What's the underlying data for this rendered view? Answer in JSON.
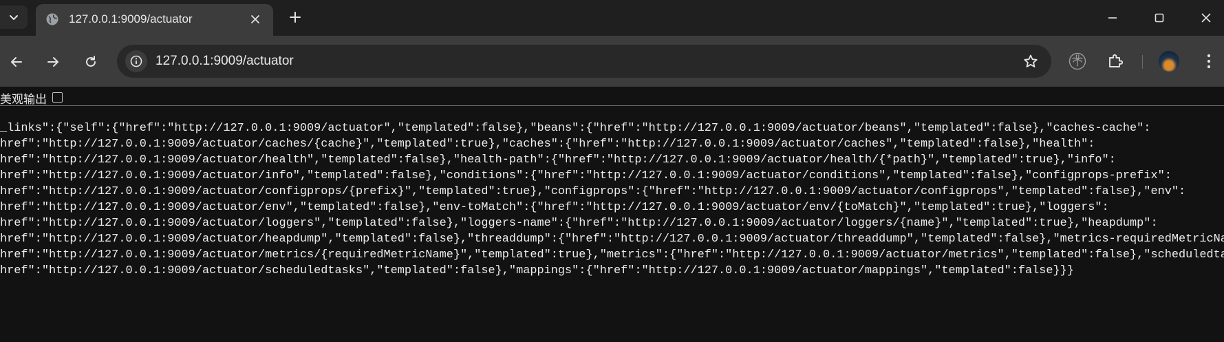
{
  "browser": {
    "tab": {
      "title": "127.0.0.1:9009/actuator"
    },
    "address_bar": {
      "url": "127.0.0.1:9009/actuator"
    },
    "icons": [
      "tab-search-icon",
      "globe-favicon-icon",
      "close-icon",
      "plus-icon",
      "minimize-icon",
      "maximize-icon",
      "window-close-icon",
      "back-arrow-icon",
      "forward-arrow-icon",
      "reload-icon",
      "site-info-icon",
      "bookmark-star-icon",
      "extension-palm-icon",
      "extensions-puzzle-icon",
      "profile-avatar",
      "more-menu-icon"
    ]
  },
  "page": {
    "pretty_print_label": "美观输出",
    "pretty_print_checked": false,
    "json_lines": [
      "_links\":{\"self\":{\"href\":\"http://127.0.0.1:9009/actuator\",\"templated\":false},\"beans\":{\"href\":\"http://127.0.0.1:9009/actuator/beans\",\"templated\":false},\"caches-cache\":",
      "href\":\"http://127.0.0.1:9009/actuator/caches/{cache}\",\"templated\":true},\"caches\":{\"href\":\"http://127.0.0.1:9009/actuator/caches\",\"templated\":false},\"health\":",
      "href\":\"http://127.0.0.1:9009/actuator/health\",\"templated\":false},\"health-path\":{\"href\":\"http://127.0.0.1:9009/actuator/health/{*path}\",\"templated\":true},\"info\":",
      "href\":\"http://127.0.0.1:9009/actuator/info\",\"templated\":false},\"conditions\":{\"href\":\"http://127.0.0.1:9009/actuator/conditions\",\"templated\":false},\"configprops-prefix\":",
      "href\":\"http://127.0.0.1:9009/actuator/configprops/{prefix}\",\"templated\":true},\"configprops\":{\"href\":\"http://127.0.0.1:9009/actuator/configprops\",\"templated\":false},\"env\":",
      "href\":\"http://127.0.0.1:9009/actuator/env\",\"templated\":false},\"env-toMatch\":{\"href\":\"http://127.0.0.1:9009/actuator/env/{toMatch}\",\"templated\":true},\"loggers\":",
      "href\":\"http://127.0.0.1:9009/actuator/loggers\",\"templated\":false},\"loggers-name\":{\"href\":\"http://127.0.0.1:9009/actuator/loggers/{name}\",\"templated\":true},\"heapdump\":",
      "href\":\"http://127.0.0.1:9009/actuator/heapdump\",\"templated\":false},\"threaddump\":{\"href\":\"http://127.0.0.1:9009/actuator/threaddump\",\"templated\":false},\"metrics-requiredMetricName\":",
      "href\":\"http://127.0.0.1:9009/actuator/metrics/{requiredMetricName}\",\"templated\":true},\"metrics\":{\"href\":\"http://127.0.0.1:9009/actuator/metrics\",\"templated\":false},\"scheduledtasks\":",
      "href\":\"http://127.0.0.1:9009/actuator/scheduledtasks\",\"templated\":false},\"mappings\":{\"href\":\"http://127.0.0.1:9009/actuator/mappings\",\"templated\":false}}}"
    ]
  },
  "colors": {
    "tabstrip_bg": "#1f1f1f",
    "toolbar_bg": "#3c3c3c",
    "omnibox_bg": "#282828",
    "page_bg": "#121212",
    "text": "#ececec"
  }
}
